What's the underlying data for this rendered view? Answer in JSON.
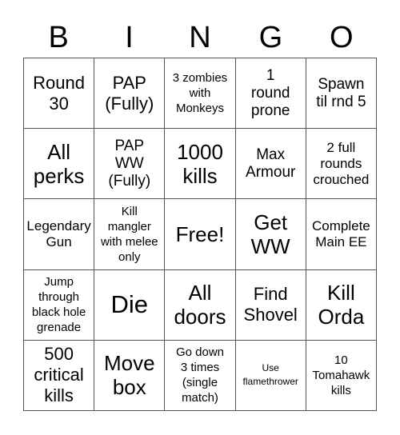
{
  "header": {
    "letters": [
      "B",
      "I",
      "N",
      "G",
      "O"
    ]
  },
  "board": {
    "cells": [
      {
        "text": "Round\n30",
        "size": "s-m"
      },
      {
        "text": "PAP\n(Fully)",
        "size": "s-m"
      },
      {
        "text": "3 zombies\nwith\nMonkeys",
        "size": "s-xs"
      },
      {
        "text": "1\nround\nprone",
        "size": "s-ms"
      },
      {
        "text": "Spawn\ntil rnd 5",
        "size": "s-ms"
      },
      {
        "text": "All\nperks",
        "size": "s-l"
      },
      {
        "text": "PAP\nWW\n(Fully)",
        "size": "s-ms"
      },
      {
        "text": "1000\nkills",
        "size": "s-l"
      },
      {
        "text": "Max\nArmour",
        "size": "s-ms"
      },
      {
        "text": "2 full\nrounds\ncrouched",
        "size": "s-s"
      },
      {
        "text": "Legendary\nGun",
        "size": "s-s"
      },
      {
        "text": "Kill\nmangler\nwith melee\nonly",
        "size": "s-xs"
      },
      {
        "text": "Free!",
        "size": "s-l"
      },
      {
        "text": "Get\nWW",
        "size": "s-l"
      },
      {
        "text": "Complete\nMain EE",
        "size": "s-s"
      },
      {
        "text": "Jump\nthrough\nblack hole\ngrenade",
        "size": "s-xs"
      },
      {
        "text": "Die",
        "size": "s-xl"
      },
      {
        "text": "All\ndoors",
        "size": "s-l"
      },
      {
        "text": "Find\nShovel",
        "size": "s-m"
      },
      {
        "text": "Kill\nOrda",
        "size": "s-l"
      },
      {
        "text": "500\ncritical\nkills",
        "size": "s-m"
      },
      {
        "text": "Move\nbox",
        "size": "s-l"
      },
      {
        "text": "Go down\n3 times\n(single\nmatch)",
        "size": "s-xs"
      },
      {
        "text": "Use\nflamethrower",
        "size": "s-xxs"
      },
      {
        "text": "10\nTomahawk\nkills",
        "size": "s-xs"
      }
    ]
  }
}
